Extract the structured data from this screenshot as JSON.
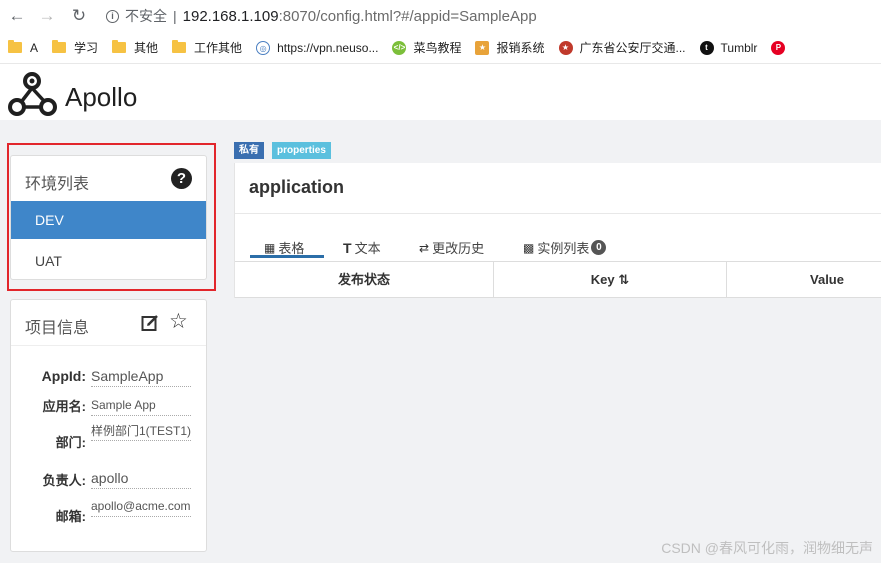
{
  "browser": {
    "insecure_label": "不安全",
    "separator": "|",
    "url_host": "192.168.1.109",
    "url_rest": ":8070/config.html?#/appid=SampleApp"
  },
  "bookmarks": [
    {
      "label": "A",
      "icon": "folder-icon"
    },
    {
      "label": "学习",
      "icon": "folder-icon"
    },
    {
      "label": "其他",
      "icon": "folder-icon"
    },
    {
      "label": "工作其他",
      "icon": "folder-icon"
    },
    {
      "label": "https://vpn.neuso...",
      "icon": "globe-icon"
    },
    {
      "label": "菜鸟教程",
      "icon": "runoob-icon"
    },
    {
      "label": "报销系统",
      "icon": "bookmark-icon"
    },
    {
      "label": "广东省公安厅交通...",
      "icon": "police-icon"
    },
    {
      "label": "Tumblr",
      "icon": "tumblr-icon"
    }
  ],
  "header": {
    "brand": "Apollo"
  },
  "env_panel": {
    "title": "环境列表",
    "items": [
      "DEV",
      "UAT"
    ],
    "selected": "DEV"
  },
  "project": {
    "title": "项目信息",
    "fields": [
      {
        "label": "AppId:",
        "value": "SampleApp"
      },
      {
        "label": "应用名:",
        "value": "Sample App"
      },
      {
        "label": "部门:",
        "value": "样例部门1(TEST1)"
      },
      {
        "label": "负责人:",
        "value": "apollo"
      },
      {
        "label": "邮箱:",
        "value": "apollo@acme.com"
      }
    ]
  },
  "namespace": {
    "tags": [
      "私有",
      "properties"
    ],
    "name": "application",
    "tabs": [
      "表格",
      "文本",
      "更改历史",
      "实例列表"
    ],
    "instance_count": "0",
    "columns": [
      "发布状态",
      "Key",
      "Value"
    ]
  },
  "watermark": "CSDN @春风可化雨，润物细无声",
  "colors": {
    "accent": "#3f86c9",
    "highlight_box": "#e2262b",
    "tag_private": "#3a6fb0",
    "tag_props": "#5bc0de"
  }
}
